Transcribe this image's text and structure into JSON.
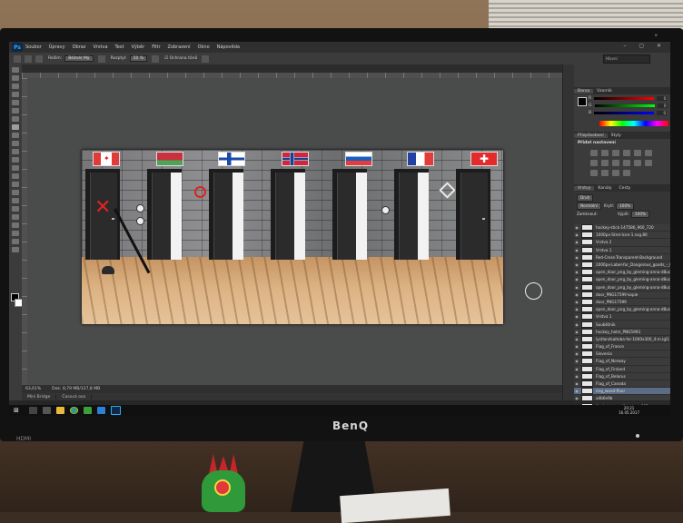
{
  "photoshop": {
    "logo": "Ps",
    "menu": [
      "Soubor",
      "Úpravy",
      "Obraz",
      "Vrstva",
      "Text",
      "Výběr",
      "Filtr",
      "Zobrazení",
      "Okno",
      "Nápověda"
    ],
    "window_controls": "– ▢ ✕",
    "options": {
      "mode_label": "Režim:",
      "mode_value": "Běžné/ Mý",
      "opacity_label": "Krytí:",
      "opacity_value": "100 %",
      "flow_label": "Rozptyl:",
      "flow_value": "50 %",
      "protect_tones": "Ochrana tónů",
      "workspace_search": "Hlavní"
    },
    "document_tab": "obrs_1 @ 63,6% (img_wood-floor, RGB/16) *",
    "status": {
      "zoom": "63,61%",
      "doc_size": "Dok: 8,79 MB/127,8 MB"
    },
    "mini_bridge": [
      "Mini Bridge",
      "Časová osa"
    ],
    "color_panel": {
      "tabs": [
        "Barva",
        "Vzorník"
      ],
      "channels": [
        {
          "label": "R",
          "value": "0",
          "color": "#d33c3c"
        },
        {
          "label": "G",
          "value": "0",
          "color": "#3cb23c"
        },
        {
          "label": "B",
          "value": "0",
          "color": "#3c5fd3"
        }
      ]
    },
    "adjust_panel": {
      "tabs": [
        "Přizpůsobení",
        "Styly"
      ],
      "title": "Přidat nastavení"
    },
    "layers_panel": {
      "tabs": [
        "Vrstvy",
        "Kanály",
        "Cesty"
      ],
      "kind_label": "Druh",
      "blend_mode": "Normální",
      "opacity_label": "Krytí:",
      "opacity_value": "100%",
      "lock_label": "Zamknout:",
      "fill_label": "Výplň:",
      "fill_value": "100%",
      "layers": [
        "hockey-stick-147586_960_720",
        "1000px-Strel-Icon-1.svg.80",
        "Vrstva 2",
        "Vrstva 1",
        "Red-Cross-Transparent-Background",
        "2000px-Label-for_Dangerous_goods_-_C",
        "open_door_png_by_gleming-anna-d8uc",
        "open_door_png_by_gleming-anna-d8uc",
        "open_door_png_by_gleming-anna-d8uc",
        "door_PNG17599 kopie",
        "door_PNG17599",
        "open_door_png_by_gleming-anna-d8uc",
        "Vrstva 1",
        "Souběžnik",
        "hockey_helm_PNG5993",
        "lystlandsaitoba-for-1000x300_4-m.lgl1",
        "Flag_of_France",
        "Slovenia",
        "Flag_of_Norway",
        "Flag_of_Finland",
        "Flag_of_Belarus",
        "Flag_of_Canada",
        "img_wood-floor",
        "a4b6e9b",
        "Kuai-stone-wall-texture-001..."
      ],
      "selected_index": 22
    },
    "tray": {
      "time": "20:21",
      "date": "16.05.2017"
    }
  },
  "monitor": {
    "brand": "BenQ",
    "left_badge": "HDMI"
  },
  "colors": {
    "accent": "#31a8ff",
    "selection": "#5b6d86",
    "canvas_bg": "#4a4b4b"
  },
  "icons": [
    "photoshop-logo",
    "brush-tool-icon",
    "eye-icon",
    "windows-start-icon",
    "chrome-icon",
    "folder-icon",
    "photoshop-taskbar-icon"
  ]
}
